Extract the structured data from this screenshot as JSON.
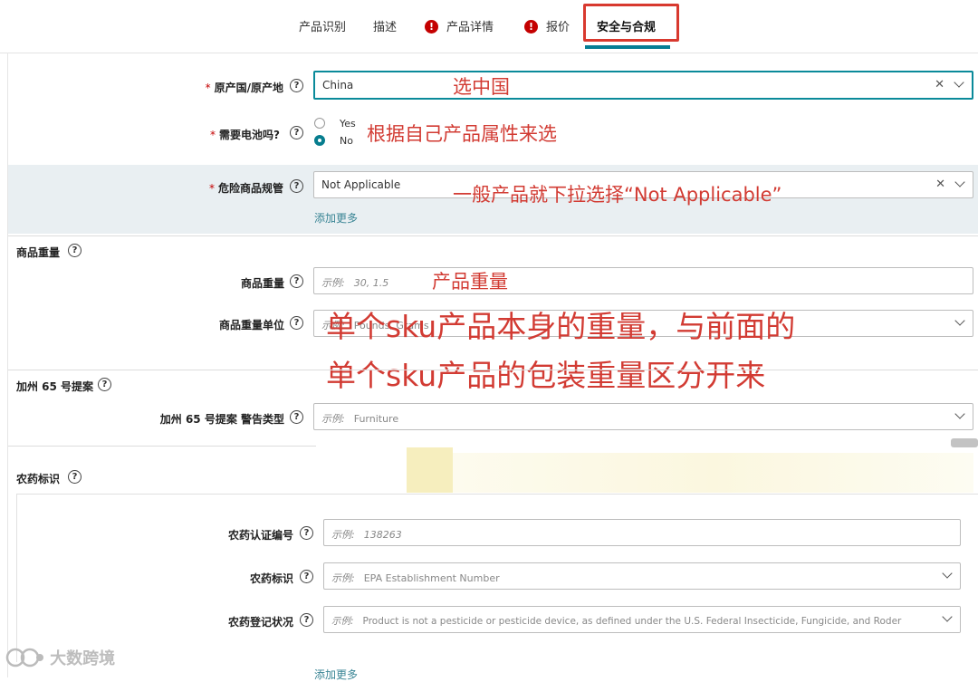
{
  "tabs": [
    {
      "label": "产品识别",
      "error": false
    },
    {
      "label": "描述",
      "error": false
    },
    {
      "label": "产品详情",
      "error": true
    },
    {
      "label": "报价",
      "error": true
    },
    {
      "label": "安全与合规",
      "error": false,
      "active": true
    }
  ],
  "fields": {
    "origin": {
      "label": "原产国/原产地",
      "value": "China",
      "required": true
    },
    "battery": {
      "label": "需要电池吗?",
      "required": true,
      "options": [
        "Yes",
        "No"
      ],
      "selected": "No"
    },
    "hazmat": {
      "label": "危险商品规管",
      "value": "Not Applicable",
      "required": true,
      "add_more": "添加更多"
    },
    "weight_section": "商品重量",
    "weight": {
      "label": "商品重量",
      "placeholder_prefix": "示例:",
      "placeholder": "30, 1.5"
    },
    "weight_unit": {
      "label": "商品重量单位",
      "placeholder_prefix": "示例:",
      "placeholder": "Pounds, Grams"
    },
    "prop65_section": "加州 65 号提案",
    "prop65": {
      "label": "加州 65 号提案 警告类型",
      "placeholder_prefix": "示例:",
      "placeholder": "Furniture"
    },
    "pesticide_section": "农药标识",
    "pesticide_cert": {
      "label": "农药认证编号",
      "placeholder_prefix": "示例:",
      "placeholder": "138263"
    },
    "pesticide_mark": {
      "label": "农药标识",
      "placeholder_prefix": "示例:",
      "placeholder": "EPA Establishment Number"
    },
    "pesticide_status": {
      "label": "农药登记状况",
      "placeholder_prefix": "示例:",
      "placeholder": "Product is not a pesticide or pesticide device, as defined under the U.S. Federal Insecticide, Fungicide, and Roder"
    },
    "add_more_bottom": "添加更多"
  },
  "annotations": {
    "origin": "选中国",
    "battery": "根据自己产品属性来选",
    "hazmat": "一般产品就下拉选择“Not Applicable”",
    "weight": "产品重量",
    "weight_note_1": "单个sku产品本身的重量，与前面的",
    "weight_note_2": "单个sku产品的包装重量区分开来"
  },
  "watermark": "大数跨境",
  "colors": {
    "accent": "#047d95",
    "error": "#c40000",
    "annotation": "#d23b33",
    "focus": "#0a8a9a"
  }
}
